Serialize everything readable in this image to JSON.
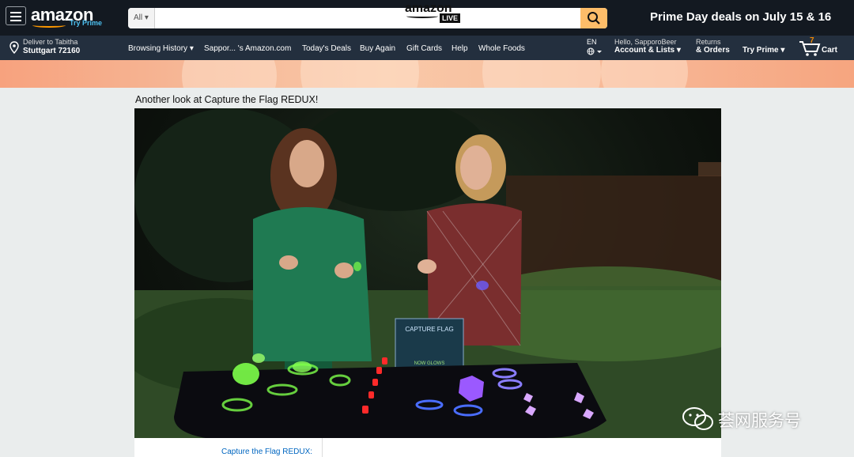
{
  "header": {
    "logo_text": "amazon",
    "try_prime": "Try Prime",
    "search": {
      "category": "All",
      "placeholder": ""
    },
    "promo": "Prime Day deals on July 15 & 16"
  },
  "deliver": {
    "line1": "Deliver to Tabitha",
    "line2": "Stuttgart 72160"
  },
  "nav": {
    "links": [
      "Browsing History",
      "Sappor... 's Amazon.com",
      "Today's Deals",
      "Buy Again",
      "Gift Cards",
      "Help",
      "Whole Foods"
    ],
    "language": "EN",
    "account_greeting": "Hello, SapporoBeer",
    "account_label": "Account & Lists",
    "returns_line1": "Returns",
    "returns_line2": "& Orders",
    "try_prime": "Try Prime",
    "cart_count": "7",
    "cart_label": "Cart"
  },
  "banner": {
    "logo": "amazon",
    "live": "LIVE"
  },
  "video": {
    "title": "Another look at Capture the Flag REDUX!",
    "box_label": "CAPTURE FLAG",
    "box_tagline": "NOW GLOWS"
  },
  "below": {
    "link": "Capture the Flag REDUX:"
  },
  "watermark": "荟网服务号",
  "colors": {
    "topbar": "#131921",
    "subnav": "#232f3e",
    "search_btn": "#febd69",
    "cart_count": "#f08804",
    "link": "#0066c0"
  }
}
